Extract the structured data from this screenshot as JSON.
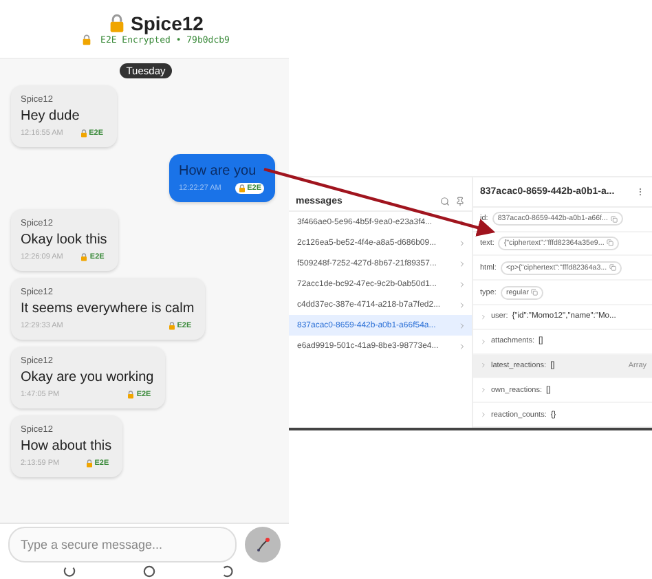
{
  "chat": {
    "title": "Spice12",
    "subtitle": "E2E Encrypted • 79b0dcb9",
    "day": "Tuesday",
    "messages": [
      {
        "kind": "incoming",
        "sender": "Spice12",
        "text": "Hey dude",
        "time": "12:16:55 AM",
        "badge": "E2E"
      },
      {
        "kind": "outgoing",
        "text": "How are you",
        "time": "12:22:27 AM",
        "badge": "E2E"
      },
      {
        "kind": "incoming",
        "sender": "Spice12",
        "text": "Okay look this",
        "time": "12:26:09 AM",
        "badge": "E2E"
      },
      {
        "kind": "incoming",
        "sender": "Spice12",
        "text": "It seems everywhere is calm",
        "time": "12:29:33 AM",
        "badge": "E2E"
      },
      {
        "kind": "incoming",
        "sender": "Spice12",
        "text": "Okay are you working",
        "time": "1:47:05 PM",
        "badge": "E2E"
      },
      {
        "kind": "incoming",
        "sender": "Spice12",
        "text": "How about this",
        "time": "2:13:59 PM",
        "badge": "E2E"
      }
    ],
    "composer": {
      "placeholder": "Type a secure message..."
    }
  },
  "inspector": {
    "list_title": "messages",
    "items": [
      {
        "label": "3f466ae0-5e96-4b5f-9ea0-e23a3f4...",
        "selected": false
      },
      {
        "label": "2c126ea5-be52-4f4e-a8a5-d686b09...",
        "selected": false
      },
      {
        "label": "f509248f-7252-427d-8b67-21f89357...",
        "selected": false
      },
      {
        "label": "72acc1de-bc92-47ec-9c2b-0ab50d1...",
        "selected": false
      },
      {
        "label": "c4dd37ec-387e-4714-a218-b7a7fed2...",
        "selected": false
      },
      {
        "label": "837acac0-8659-442b-a0b1-a66f54a...",
        "selected": true
      },
      {
        "label": "e6ad9919-501c-41a9-8be3-98773e4...",
        "selected": false
      }
    ],
    "detail_title": "837acac0-8659-442b-a0b1-a...",
    "fields": [
      {
        "kind": "chip",
        "key": "id:",
        "value": "837acac0-8659-442b-a0b1-a66f..."
      },
      {
        "kind": "chip",
        "key": "text:",
        "value": "{\"ciphertext\":\"fffd82364a35e9..."
      },
      {
        "kind": "chip",
        "key": "html:",
        "value": "<p>{\"ciphertext\":\"fffd82364a3..."
      },
      {
        "kind": "chip",
        "key": "type:",
        "value": "regular"
      },
      {
        "kind": "expandable",
        "key": "user:",
        "value": "{\"id\":\"Momo12\",\"name\":\"Mo...",
        "highlighted": false
      },
      {
        "kind": "expandable",
        "key": "attachments:",
        "value": "[]",
        "highlighted": false
      },
      {
        "kind": "expandable",
        "key": "latest_reactions:",
        "value": "[]",
        "type_label": "Array",
        "highlighted": true
      },
      {
        "kind": "expandable",
        "key": "own_reactions:",
        "value": "[]",
        "highlighted": false
      },
      {
        "kind": "expandable",
        "key": "reaction_counts:",
        "value": "{}",
        "highlighted": false
      }
    ]
  }
}
